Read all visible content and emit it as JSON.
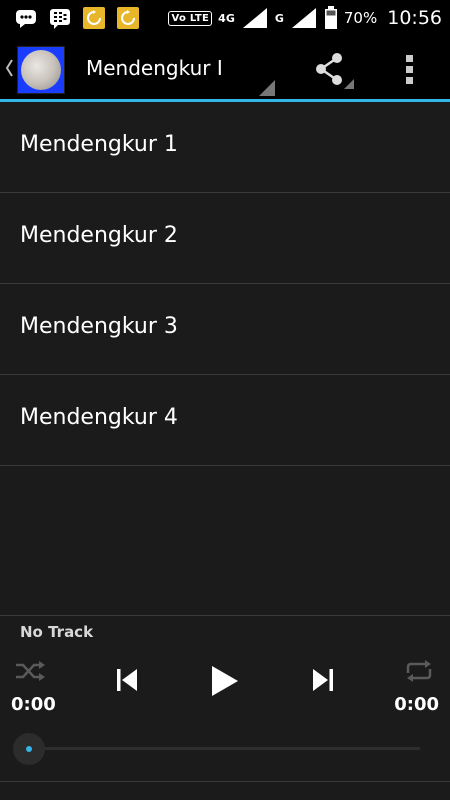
{
  "status_bar": {
    "volte": "Vo LTE",
    "network_primary": "4G",
    "network_secondary": "G",
    "battery_percent": "70%",
    "time": "10:56",
    "notification_icons": [
      "bbm-chat-icon",
      "blackberry-icon",
      "sync-icon",
      "sync-icon"
    ]
  },
  "action_bar": {
    "title": "Mendengkur I",
    "app_icon": "app-avatar-icon",
    "share_icon": "share-icon",
    "overflow_icon": "overflow-menu-icon"
  },
  "tracks": [
    {
      "label": "Mendengkur 1"
    },
    {
      "label": "Mendengkur 2"
    },
    {
      "label": "Mendengkur 3"
    },
    {
      "label": "Mendengkur 4"
    }
  ],
  "player": {
    "track_name": "No Track",
    "elapsed": "0:00",
    "duration": "0:00",
    "progress": 0,
    "accent_color": "#33b5e5"
  }
}
